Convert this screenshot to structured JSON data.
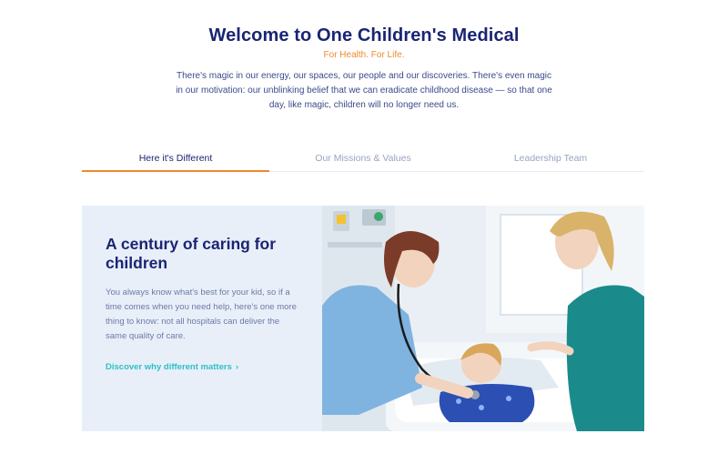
{
  "hero": {
    "title": "Welcome to One Children's Medical",
    "tagline": "For Health. For Life.",
    "intro": "There's magic in our energy, our spaces, our people and our discoveries. There's even magic in our motivation: our unblinking belief that we can eradicate childhood disease — so that one day, like magic, children will no longer need us."
  },
  "tabs": [
    {
      "label": "Here it's Different",
      "active": true
    },
    {
      "label": "Our Missions & Values",
      "active": false
    },
    {
      "label": "Leadership Team",
      "active": false
    }
  ],
  "feature": {
    "heading": "A century of caring for children",
    "body": "You always know what's best for your kid, so if a time comes when you need help, here's one more thing to know: not all hospitals can deliver the same quality of care.",
    "link_label": "Discover why different matters",
    "link_icon": "chevron-right-icon",
    "photo_subject": "nurse-with-stethoscope-examining-child-in-hospital-bed-with-mother"
  },
  "colors": {
    "brand_navy": "#1a2573",
    "accent_orange": "#f0892c",
    "link_teal": "#2fbfc6",
    "card_bg": "#e8eff9"
  }
}
